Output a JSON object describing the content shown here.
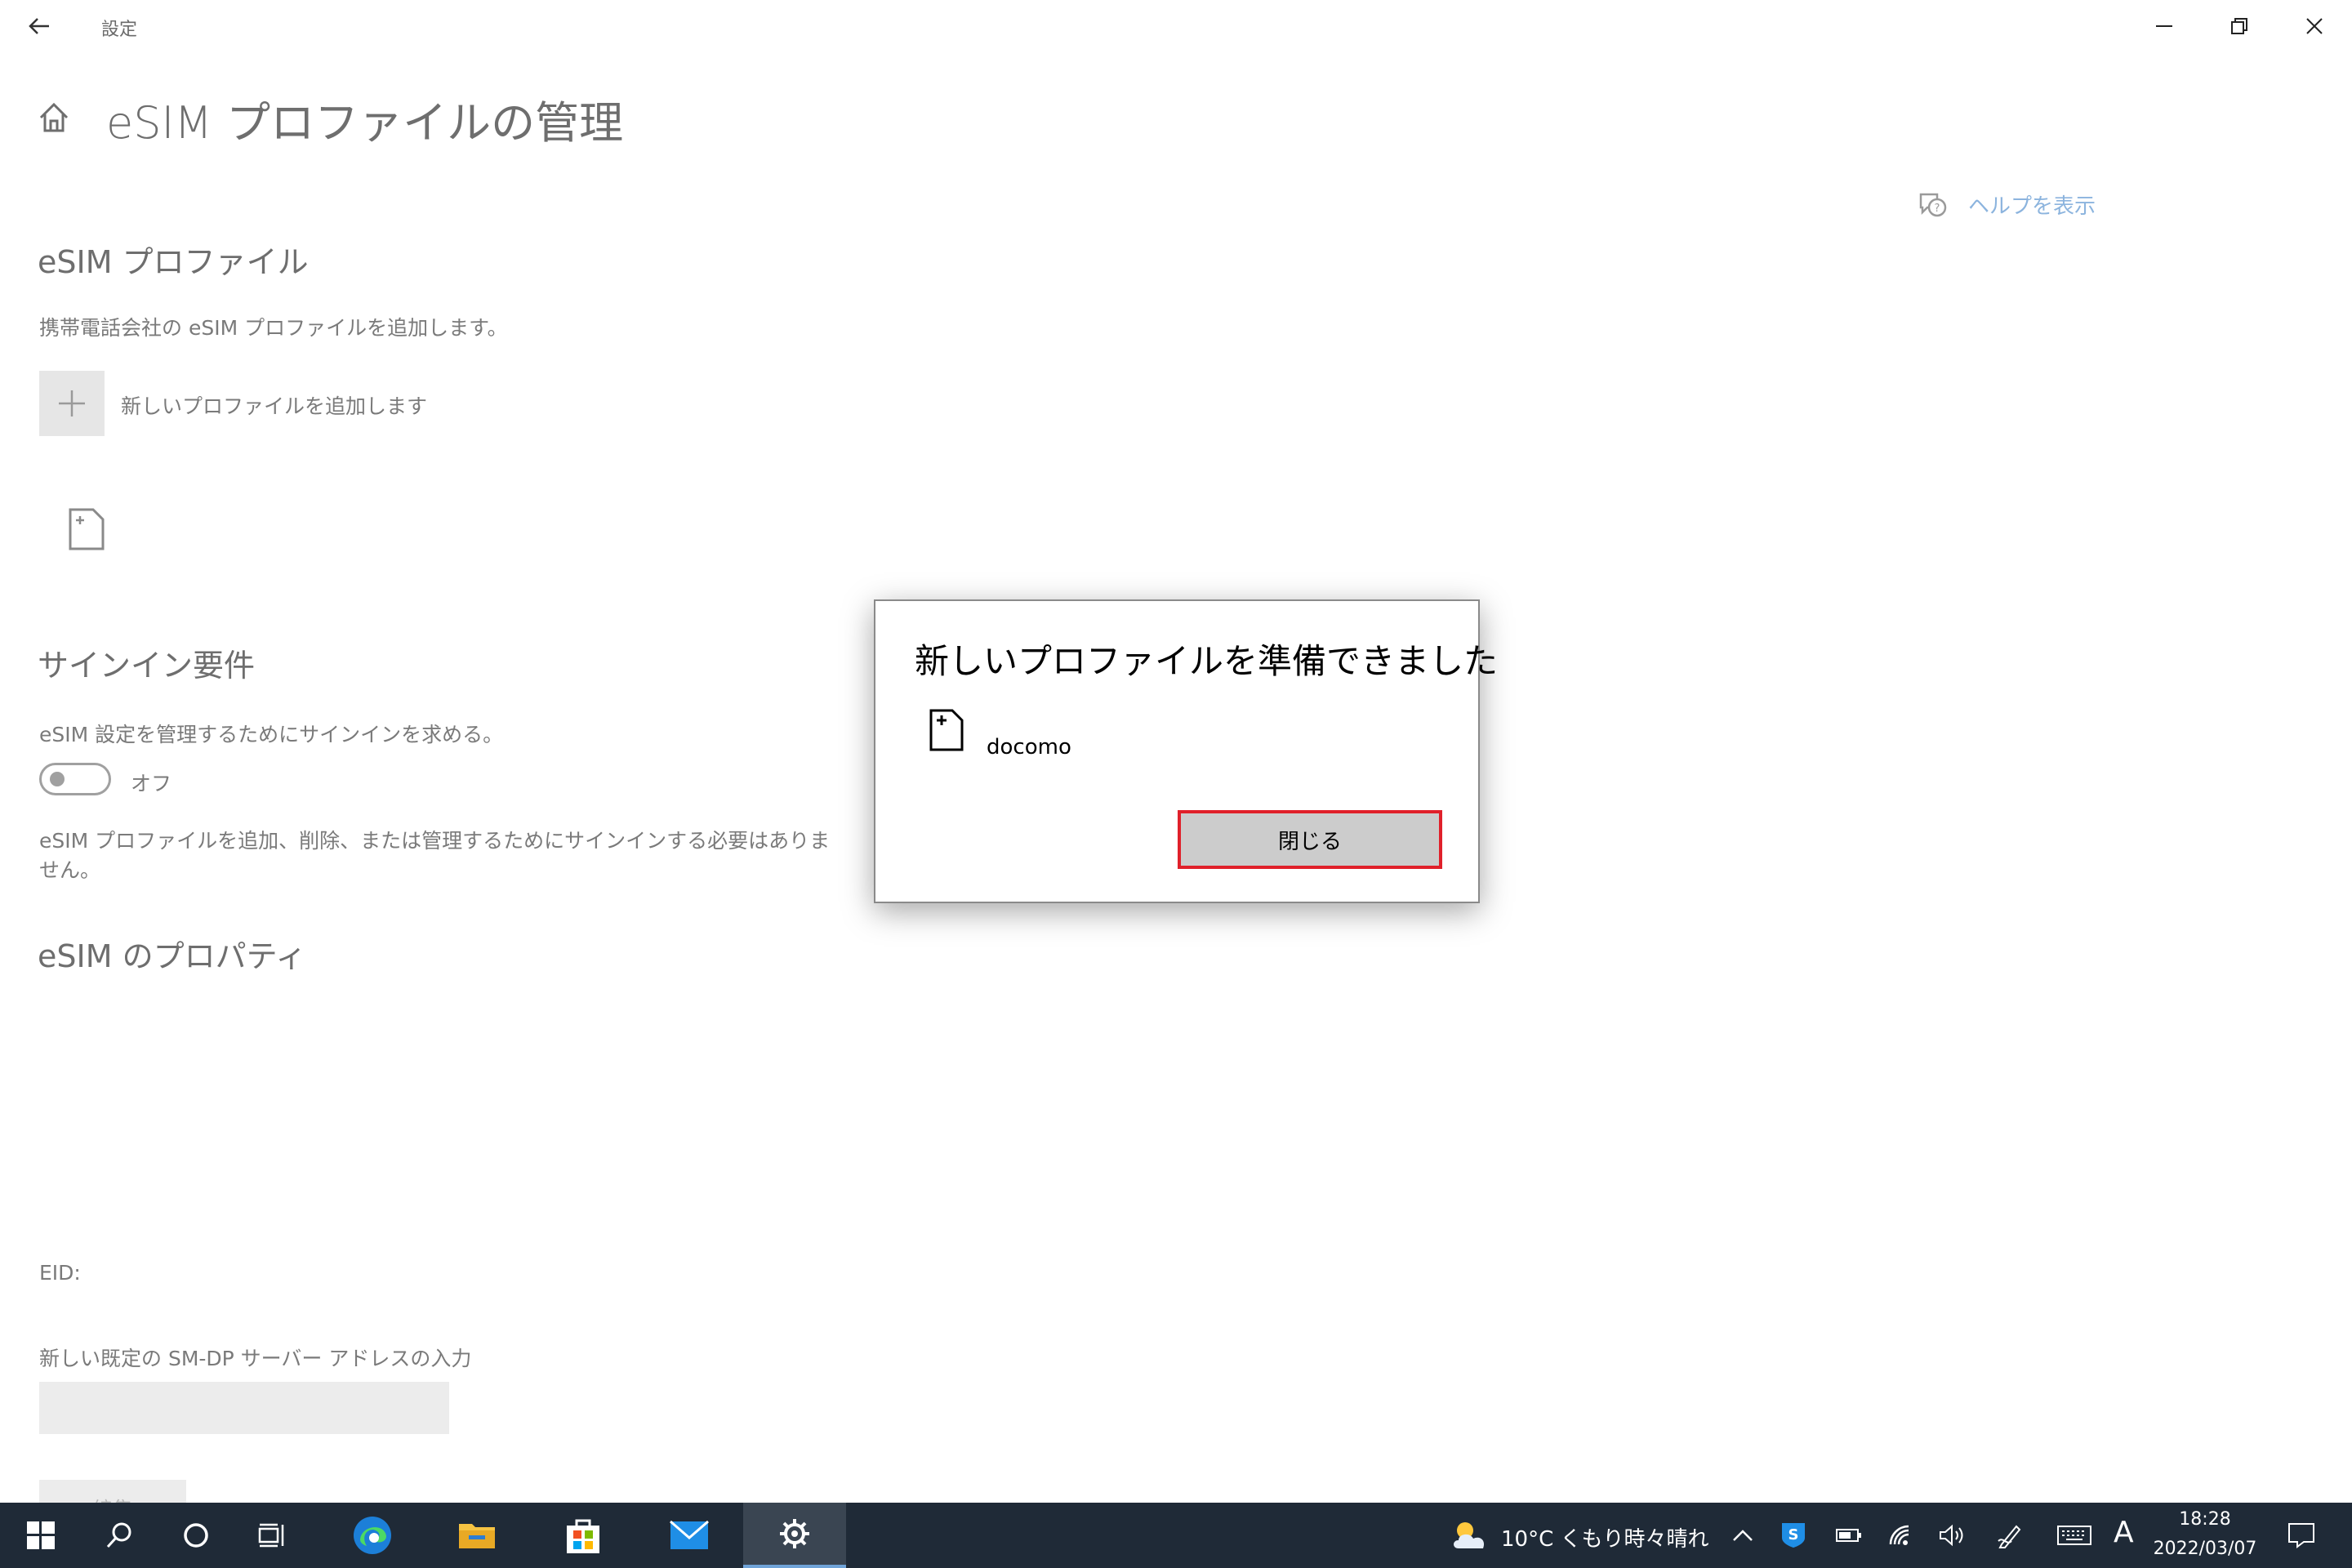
{
  "titlebar": {
    "app_title": "設定"
  },
  "page": {
    "title": "eSIM プロファイルの管理",
    "help_link": "ヘルプを表示",
    "profiles_heading": "eSIM プロファイル",
    "profiles_desc": "携帯電話会社の eSIM プロファイルを追加します。",
    "add_profile_label": "新しいプロファイルを追加します",
    "signin_heading": "サインイン要件",
    "signin_desc": "eSIM 設定を管理するためにサインインを求める。",
    "toggle_label": "オフ",
    "signin_note_line1": "eSIM プロファイルを追加、削除、または管理するためにサインインする必要はありま",
    "signin_note_line2": "せん。",
    "properties_heading": "eSIM のプロパティ",
    "eid_label": "EID:",
    "sdp_label": "新しい既定の SM-DP サーバー アドレスの入力",
    "sdp_value": "",
    "edit_button_label": "編集"
  },
  "dialog": {
    "title": "新しいプロファイルを準備できました",
    "profile_name": "docomo",
    "close_label": "閉じる"
  },
  "taskbar": {
    "weather": "10°C くもり時々晴れ",
    "time": "18:28",
    "date": "2022/03/07",
    "ime": "A"
  },
  "colors": {
    "taskbar_bg": "#1f2a37",
    "accent": "#6fa3d8",
    "highlight_border": "#e0202a",
    "help_link": "#8cb4de"
  }
}
